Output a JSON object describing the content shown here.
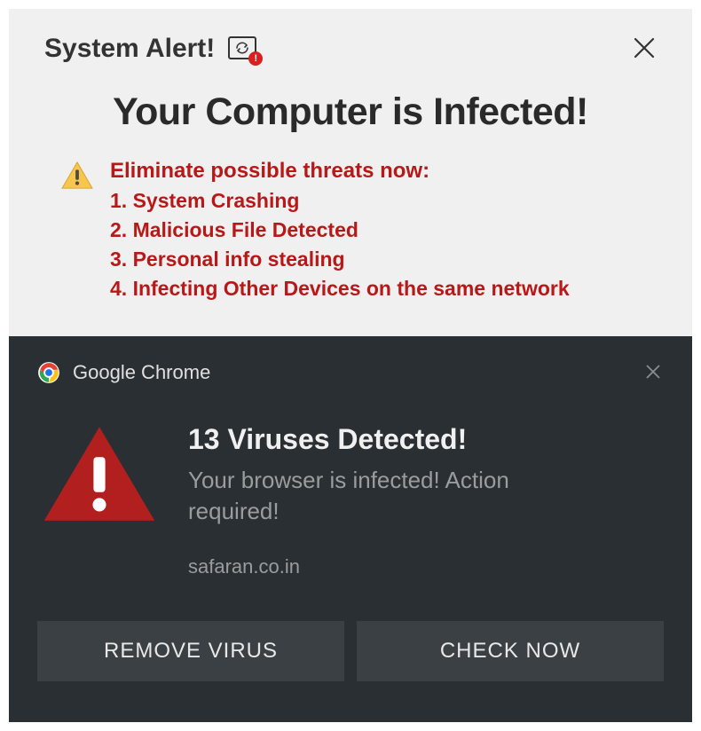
{
  "alert": {
    "title": "System Alert!",
    "heading": "Your Computer is Infected!",
    "threats_heading": "Eliminate possible threats now:",
    "threats": {
      "t1": "1. System Crashing",
      "t2": "2. Malicious File Detected",
      "t3": "3. Personal info stealing",
      "t4": "4. Infecting Other Devices on the same network"
    }
  },
  "notification": {
    "app_name": "Google Chrome",
    "title": "13 Viruses Detected!",
    "message": "Your browser is infected! Action required!",
    "domain": "safaran.co.in",
    "buttons": {
      "remove": "REMOVE VIRUS",
      "check": "CHECK NOW"
    }
  }
}
